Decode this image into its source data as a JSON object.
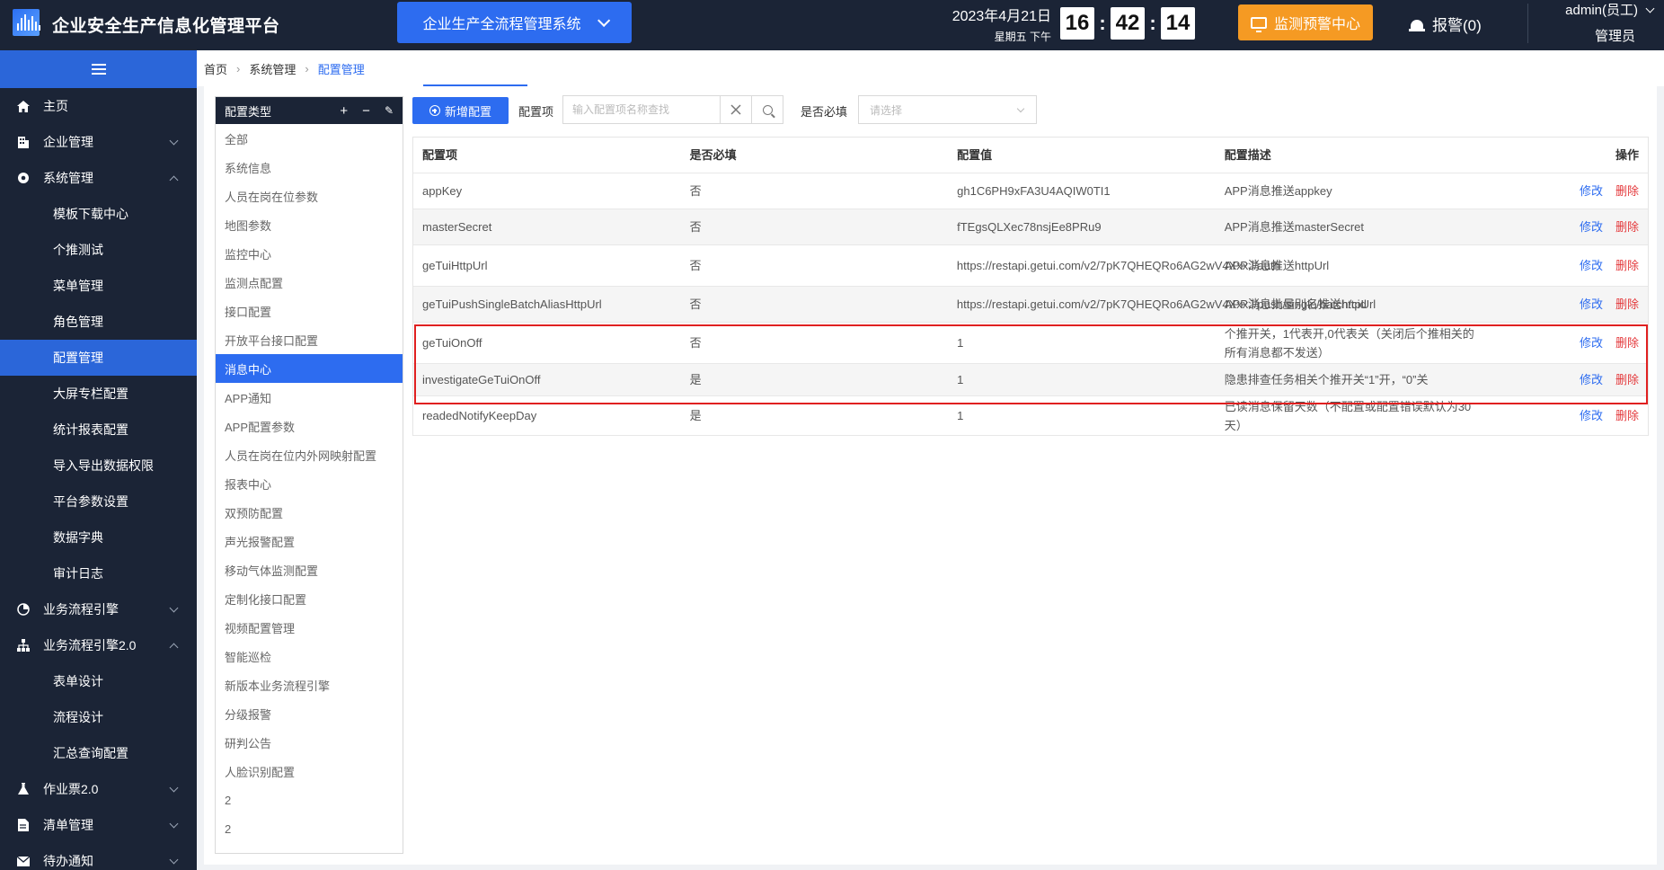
{
  "header": {
    "app_title": "企业安全生产信息化管理平台",
    "system_switch": "企业生产全流程管理系统",
    "date": "2023年4月21日",
    "weekday": "星期五  下午",
    "clock": {
      "h": "16",
      "m": "42",
      "s": "14"
    },
    "monitor_button": "监测预警中心",
    "alarm_label": "报警(0)",
    "user_name": "admin(员工)",
    "user_role": "管理员"
  },
  "sidebar": {
    "items": [
      {
        "label": "主页",
        "icon": "home-icon"
      },
      {
        "label": "企业管理",
        "icon": "building-icon"
      },
      {
        "label": "系统管理",
        "icon": "gear-icon"
      }
    ],
    "sub_items": [
      "模板下载中心",
      "个推测试",
      "菜单管理",
      "角色管理",
      "配置管理",
      "大屏专栏配置",
      "统计报表配置",
      "导入导出数据权限",
      "平台参数设置",
      "数据字典",
      "审计日志"
    ],
    "items_b": [
      {
        "label": "业务流程引擎",
        "icon": "workflow-icon"
      },
      {
        "label": "业务流程引擎2.0",
        "icon": "sitemap-icon"
      }
    ],
    "sub_items_b": [
      "表单设计",
      "流程设计",
      "汇总查询配置"
    ],
    "items_c": [
      {
        "label": "作业票2.0",
        "icon": "flask-icon"
      },
      {
        "label": "清单管理",
        "icon": "list-icon"
      },
      {
        "label": "待办通知",
        "icon": "mail-icon"
      }
    ]
  },
  "breadcrumb": [
    "首页",
    "系统管理",
    "配置管理"
  ],
  "tree": {
    "title": "配置类型",
    "tools": [
      "+",
      "−",
      "✎"
    ],
    "items": [
      "全部",
      "系统信息",
      "人员在岗在位参数",
      "地图参数",
      "监控中心",
      "监测点配置",
      "接口配置",
      "开放平台接口配置",
      "消息中心",
      "APP通知",
      "APP配置参数",
      "人员在岗在位内外网映射配置",
      "报表中心",
      "双预防配置",
      "声光报警配置",
      "移动气体监测配置",
      "定制化接口配置",
      "视频配置管理",
      "智能巡检",
      "新版本业务流程引擎",
      "分级报警",
      "研判公告",
      "人脸识别配置",
      "2",
      "2"
    ]
  },
  "toolbar": {
    "add_button": "新增配置",
    "search_label": "配置项",
    "search_placeholder": "输入配置项名称查找",
    "required_label": "是否必填",
    "required_placeholder": "请选择"
  },
  "table": {
    "columns": [
      "配置项",
      "是否必填",
      "配置值",
      "配置描述",
      "操作"
    ],
    "edit_label": "修改",
    "delete_label": "删除",
    "rows": [
      {
        "key": "appKey",
        "required": "否",
        "value": "gh1C6PH9xFA3U4AQIW0TI1",
        "desc": "APP消息推送appkey"
      },
      {
        "key": "masterSecret",
        "required": "否",
        "value": "fTEgsQLXec78nsjEe8PRu9",
        "desc": "APP消息推送masterSecret"
      },
      {
        "key": "geTuiHttpUrl",
        "required": "否",
        "value": "https://restapi.getui.com/v2/7pK7QHEQRo6AG2wV4XxxJ/auth",
        "desc": "APP消息推送httpUrl"
      },
      {
        "key": "geTuiPushSingleBatchAliasHttpUrl",
        "required": "否",
        "value": "https://restapi.getui.com/v2/7pK7QHEQRo6AG2wV4XxxJ/push/single/batch/cid",
        "desc": "APP消息批量别名推送httpUrl"
      },
      {
        "key": "geTuiOnOff",
        "required": "否",
        "value": "1",
        "desc": "个推开关，1代表开,0代表关（关闭后个推相关的所有消息都不发送）"
      },
      {
        "key": "investigateGeTuiOnOff",
        "required": "是",
        "value": "1",
        "desc": "隐患排查任务相关个推开关“1”开，“0”关"
      },
      {
        "key": "readedNotifyKeepDay",
        "required": "是",
        "value": "1",
        "desc": "已读消息保留天数（不配置或配置错误默认为30天）"
      }
    ]
  }
}
